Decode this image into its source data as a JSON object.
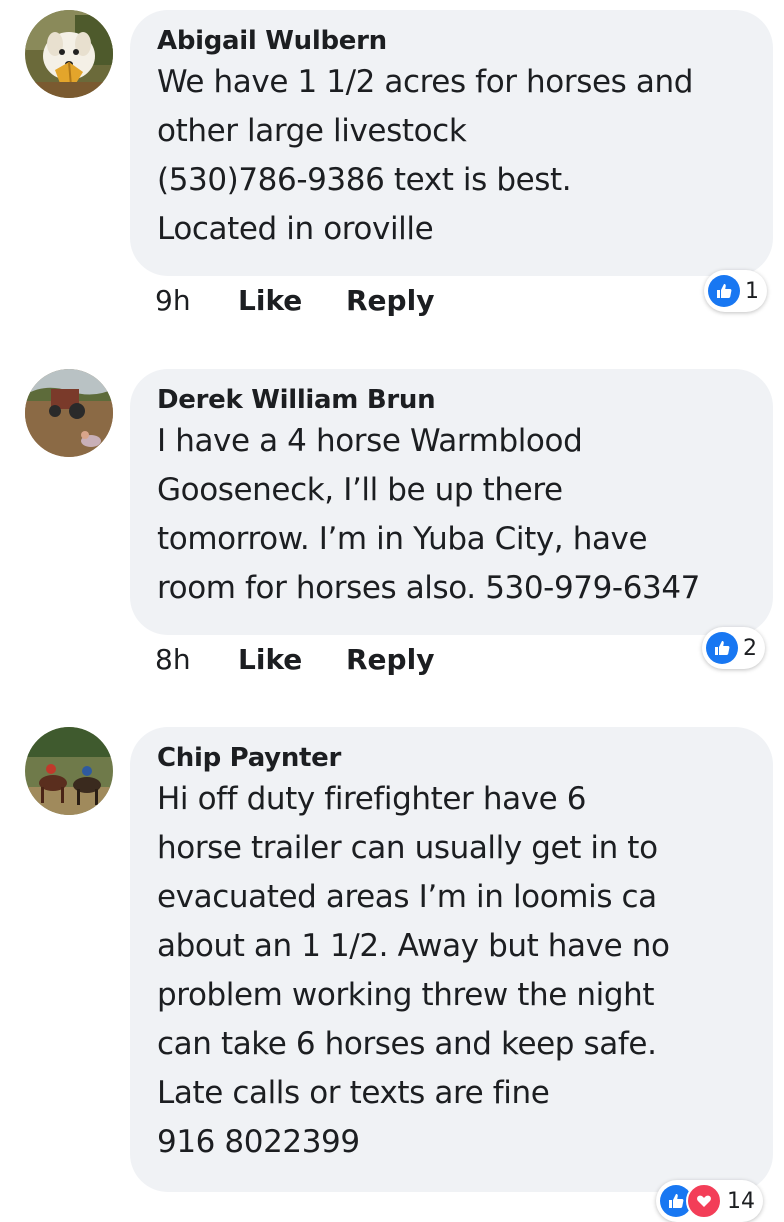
{
  "comments": [
    {
      "author": "Abigail Wulbern",
      "text": "We have 1 1/2 acres for horses and\nother large livestock\n(530)786-9386 text is best.\nLocated in oroville",
      "time": "9h",
      "like_label": "Like",
      "reply_label": "Reply",
      "reaction_count": "1",
      "avatar_icon": "dog-avatar"
    },
    {
      "author": "Derek William Brun",
      "text": "I have a 4 horse Warmblood\nGooseneck, I’ll be up there\ntomorrow. I’m in Yuba City, have\nroom for horses also. 530-979-6347",
      "time": "8h",
      "like_label": "Like",
      "reply_label": "Reply",
      "reaction_count": "2",
      "avatar_icon": "farm-avatar"
    },
    {
      "author": "Chip Paynter",
      "text": "Hi off duty firefighter have 6\nhorse trailer can usually get in to\nevacuated areas I’m in loomis ca\nabout an 1 1/2. Away but have no\nproblem working threw the night\ncan take 6 horses and keep safe.\nLate calls or texts are fine\n916 8022399",
      "reaction_count": "14",
      "avatar_icon": "horses-avatar"
    }
  ],
  "colors": {
    "bubble": "#f0f2f5",
    "like_blue": "#1877f2",
    "love_red": "#f33e58"
  }
}
